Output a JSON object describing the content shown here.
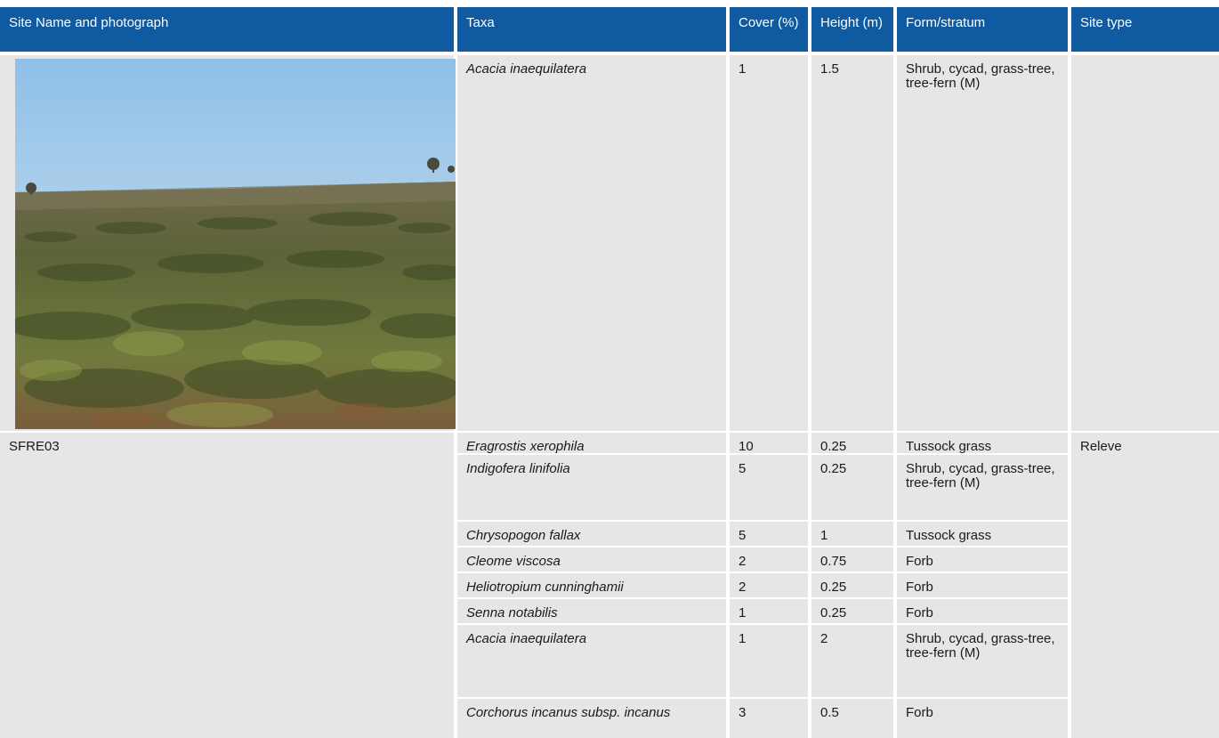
{
  "table": {
    "headers": {
      "site": "Site Name and photograph",
      "taxa": "Taxa",
      "cover": "Cover (%)",
      "height": "Height (m)",
      "form": "Form/stratum",
      "site_type": "Site type"
    },
    "photo_row": {
      "taxa": "Acacia inaequilatera",
      "cover": "1",
      "height": "1.5",
      "form": "Shrub, cycad, grass-tree, tree-fern (M)"
    },
    "site": {
      "name": "SFRE03",
      "type": "Releve"
    },
    "rows": [
      {
        "taxa": "Eragrostis xerophila",
        "cover": "10",
        "height": "0.25",
        "form": "Tussock grass"
      },
      {
        "taxa": "Indigofera linifolia",
        "cover": "5",
        "height": "0.25",
        "form": "Shrub, cycad, grass-tree, tree-fern (M)"
      },
      {
        "taxa": "Chrysopogon fallax",
        "cover": "5",
        "height": "1",
        "form": "Tussock grass"
      },
      {
        "taxa": "Cleome viscosa",
        "cover": "2",
        "height": "0.75",
        "form": "Forb"
      },
      {
        "taxa": "Heliotropium cunninghamii",
        "cover": "2",
        "height": "0.25",
        "form": "Forb"
      },
      {
        "taxa": "Senna notabilis",
        "cover": "1",
        "height": "0.25",
        "form": "Forb"
      },
      {
        "taxa": "Acacia inaequilatera",
        "cover": "1",
        "height": "2",
        "form": "Shrub, cycad, grass-tree, tree-fern (M)"
      },
      {
        "taxa": "Corchorus incanus subsp. incanus",
        "cover": "3",
        "height": "0.5",
        "form": "Forb"
      }
    ]
  },
  "colors": {
    "header_bg": "#0f5aa0",
    "header_text": "#ffffff",
    "cell_bg": "#e6e6e6"
  }
}
